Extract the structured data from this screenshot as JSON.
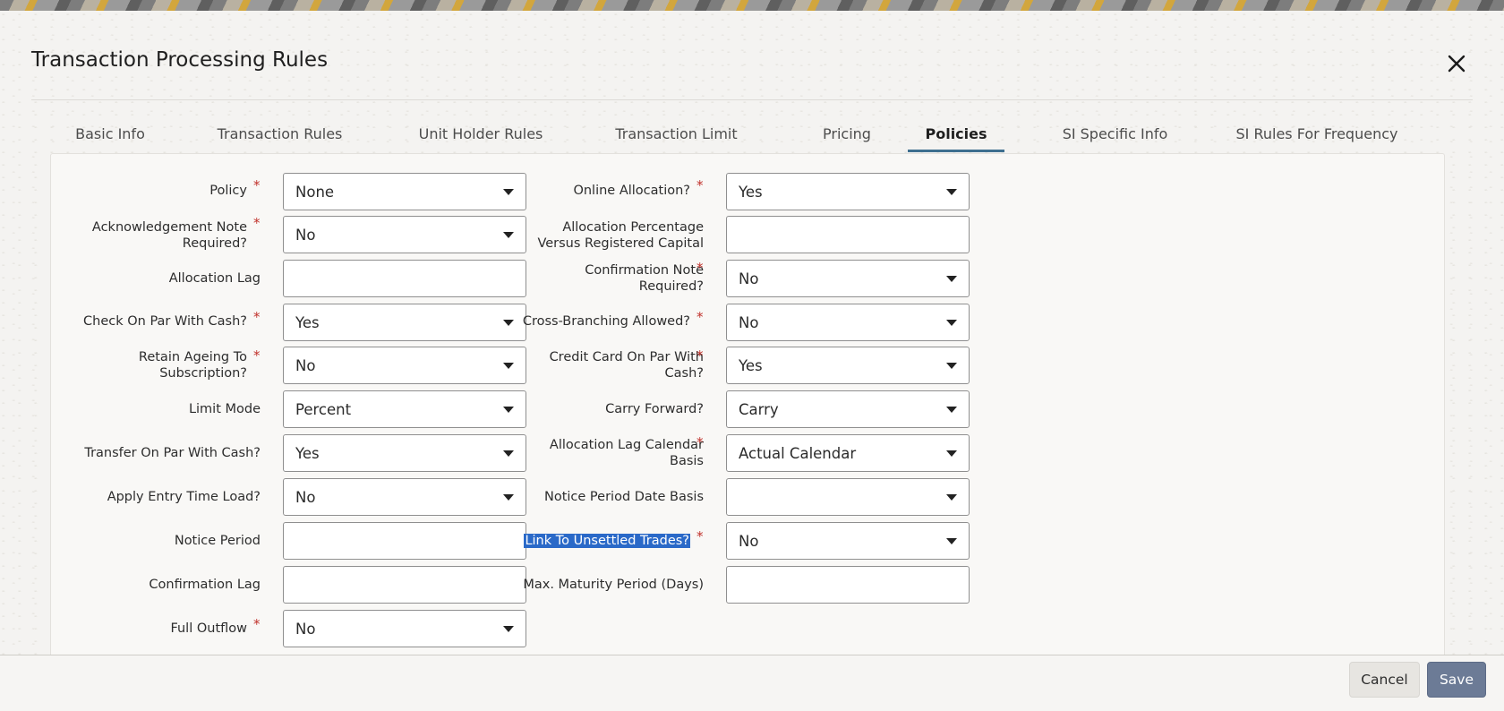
{
  "dialog": {
    "title": "Transaction Processing Rules"
  },
  "tabs": [
    {
      "label": "Basic Info"
    },
    {
      "label": "Transaction Rules"
    },
    {
      "label": "Unit Holder Rules"
    },
    {
      "label": "Transaction Limit"
    },
    {
      "label": "Pricing"
    },
    {
      "label": "Policies"
    },
    {
      "label": "SI Specific Info"
    },
    {
      "label": "SI Rules For Frequency"
    }
  ],
  "active_tab": "Policies",
  "form": {
    "left": [
      {
        "label": "Policy",
        "required": true,
        "type": "select",
        "value": "None"
      },
      {
        "label": "Acknowledgement Note Required?",
        "required": true,
        "type": "select",
        "value": "No"
      },
      {
        "label": "Allocation Lag",
        "required": false,
        "type": "text",
        "value": ""
      },
      {
        "label": "Check On Par With Cash?",
        "required": true,
        "type": "select",
        "value": "Yes"
      },
      {
        "label": "Retain Ageing To Subscription?",
        "required": true,
        "type": "select",
        "value": "No"
      },
      {
        "label": "Limit Mode",
        "required": false,
        "type": "select",
        "value": "Percent"
      },
      {
        "label": "Transfer On Par With Cash?",
        "required": false,
        "type": "select",
        "value": "Yes"
      },
      {
        "label": "Apply Entry Time Load?",
        "required": false,
        "type": "select",
        "value": "No"
      },
      {
        "label": "Notice Period",
        "required": false,
        "type": "text",
        "value": ""
      },
      {
        "label": "Confirmation Lag",
        "required": false,
        "type": "text",
        "value": ""
      },
      {
        "label": "Full Outflow",
        "required": true,
        "type": "select",
        "value": "No"
      }
    ],
    "right": [
      {
        "label": "Online Allocation?",
        "required": true,
        "type": "select",
        "value": "Yes"
      },
      {
        "label": "Allocation Percentage Versus Registered Capital",
        "required": false,
        "type": "text",
        "value": ""
      },
      {
        "label": "Confirmation Note Required?",
        "required": true,
        "type": "select",
        "value": "No"
      },
      {
        "label": "Cross-Branching Allowed?",
        "required": true,
        "type": "select",
        "value": "No"
      },
      {
        "label": "Credit Card On Par With Cash?",
        "required": true,
        "type": "select",
        "value": "Yes"
      },
      {
        "label": "Carry Forward?",
        "required": false,
        "type": "select",
        "value": "Carry"
      },
      {
        "label": "Allocation Lag Calendar Basis",
        "required": true,
        "type": "select",
        "value": "Actual Calendar"
      },
      {
        "label": "Notice Period Date Basis",
        "required": false,
        "type": "select",
        "value": ""
      },
      {
        "label": "Link To Unsettled Trades?",
        "required": true,
        "type": "select",
        "value": "No",
        "selected_text": true
      },
      {
        "label": "Max. Maturity Period (Days)",
        "required": false,
        "type": "text",
        "value": ""
      }
    ]
  },
  "footer": {
    "cancel_label": "Cancel",
    "save_label": "Save"
  },
  "colors": {
    "accent": "#3e6f8f",
    "required": "#c0312b",
    "save_button": "#6c7b96",
    "selection": "#2a69c8"
  }
}
